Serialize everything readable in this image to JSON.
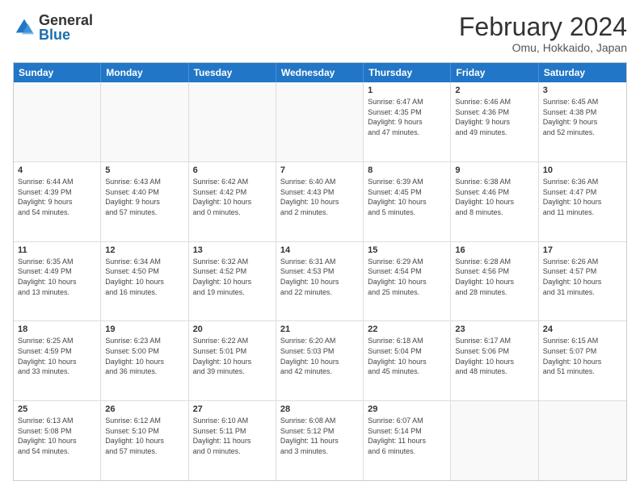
{
  "logo": {
    "general": "General",
    "blue": "Blue"
  },
  "title": "February 2024",
  "subtitle": "Omu, Hokkaido, Japan",
  "header_days": [
    "Sunday",
    "Monday",
    "Tuesday",
    "Wednesday",
    "Thursday",
    "Friday",
    "Saturday"
  ],
  "rows": [
    [
      {
        "day": "",
        "info": ""
      },
      {
        "day": "",
        "info": ""
      },
      {
        "day": "",
        "info": ""
      },
      {
        "day": "",
        "info": ""
      },
      {
        "day": "1",
        "info": "Sunrise: 6:47 AM\nSunset: 4:35 PM\nDaylight: 9 hours\nand 47 minutes."
      },
      {
        "day": "2",
        "info": "Sunrise: 6:46 AM\nSunset: 4:36 PM\nDaylight: 9 hours\nand 49 minutes."
      },
      {
        "day": "3",
        "info": "Sunrise: 6:45 AM\nSunset: 4:38 PM\nDaylight: 9 hours\nand 52 minutes."
      }
    ],
    [
      {
        "day": "4",
        "info": "Sunrise: 6:44 AM\nSunset: 4:39 PM\nDaylight: 9 hours\nand 54 minutes."
      },
      {
        "day": "5",
        "info": "Sunrise: 6:43 AM\nSunset: 4:40 PM\nDaylight: 9 hours\nand 57 minutes."
      },
      {
        "day": "6",
        "info": "Sunrise: 6:42 AM\nSunset: 4:42 PM\nDaylight: 10 hours\nand 0 minutes."
      },
      {
        "day": "7",
        "info": "Sunrise: 6:40 AM\nSunset: 4:43 PM\nDaylight: 10 hours\nand 2 minutes."
      },
      {
        "day": "8",
        "info": "Sunrise: 6:39 AM\nSunset: 4:45 PM\nDaylight: 10 hours\nand 5 minutes."
      },
      {
        "day": "9",
        "info": "Sunrise: 6:38 AM\nSunset: 4:46 PM\nDaylight: 10 hours\nand 8 minutes."
      },
      {
        "day": "10",
        "info": "Sunrise: 6:36 AM\nSunset: 4:47 PM\nDaylight: 10 hours\nand 11 minutes."
      }
    ],
    [
      {
        "day": "11",
        "info": "Sunrise: 6:35 AM\nSunset: 4:49 PM\nDaylight: 10 hours\nand 13 minutes."
      },
      {
        "day": "12",
        "info": "Sunrise: 6:34 AM\nSunset: 4:50 PM\nDaylight: 10 hours\nand 16 minutes."
      },
      {
        "day": "13",
        "info": "Sunrise: 6:32 AM\nSunset: 4:52 PM\nDaylight: 10 hours\nand 19 minutes."
      },
      {
        "day": "14",
        "info": "Sunrise: 6:31 AM\nSunset: 4:53 PM\nDaylight: 10 hours\nand 22 minutes."
      },
      {
        "day": "15",
        "info": "Sunrise: 6:29 AM\nSunset: 4:54 PM\nDaylight: 10 hours\nand 25 minutes."
      },
      {
        "day": "16",
        "info": "Sunrise: 6:28 AM\nSunset: 4:56 PM\nDaylight: 10 hours\nand 28 minutes."
      },
      {
        "day": "17",
        "info": "Sunrise: 6:26 AM\nSunset: 4:57 PM\nDaylight: 10 hours\nand 31 minutes."
      }
    ],
    [
      {
        "day": "18",
        "info": "Sunrise: 6:25 AM\nSunset: 4:59 PM\nDaylight: 10 hours\nand 33 minutes."
      },
      {
        "day": "19",
        "info": "Sunrise: 6:23 AM\nSunset: 5:00 PM\nDaylight: 10 hours\nand 36 minutes."
      },
      {
        "day": "20",
        "info": "Sunrise: 6:22 AM\nSunset: 5:01 PM\nDaylight: 10 hours\nand 39 minutes."
      },
      {
        "day": "21",
        "info": "Sunrise: 6:20 AM\nSunset: 5:03 PM\nDaylight: 10 hours\nand 42 minutes."
      },
      {
        "day": "22",
        "info": "Sunrise: 6:18 AM\nSunset: 5:04 PM\nDaylight: 10 hours\nand 45 minutes."
      },
      {
        "day": "23",
        "info": "Sunrise: 6:17 AM\nSunset: 5:06 PM\nDaylight: 10 hours\nand 48 minutes."
      },
      {
        "day": "24",
        "info": "Sunrise: 6:15 AM\nSunset: 5:07 PM\nDaylight: 10 hours\nand 51 minutes."
      }
    ],
    [
      {
        "day": "25",
        "info": "Sunrise: 6:13 AM\nSunset: 5:08 PM\nDaylight: 10 hours\nand 54 minutes."
      },
      {
        "day": "26",
        "info": "Sunrise: 6:12 AM\nSunset: 5:10 PM\nDaylight: 10 hours\nand 57 minutes."
      },
      {
        "day": "27",
        "info": "Sunrise: 6:10 AM\nSunset: 5:11 PM\nDaylight: 11 hours\nand 0 minutes."
      },
      {
        "day": "28",
        "info": "Sunrise: 6:08 AM\nSunset: 5:12 PM\nDaylight: 11 hours\nand 3 minutes."
      },
      {
        "day": "29",
        "info": "Sunrise: 6:07 AM\nSunset: 5:14 PM\nDaylight: 11 hours\nand 6 minutes."
      },
      {
        "day": "",
        "info": ""
      },
      {
        "day": "",
        "info": ""
      }
    ]
  ]
}
